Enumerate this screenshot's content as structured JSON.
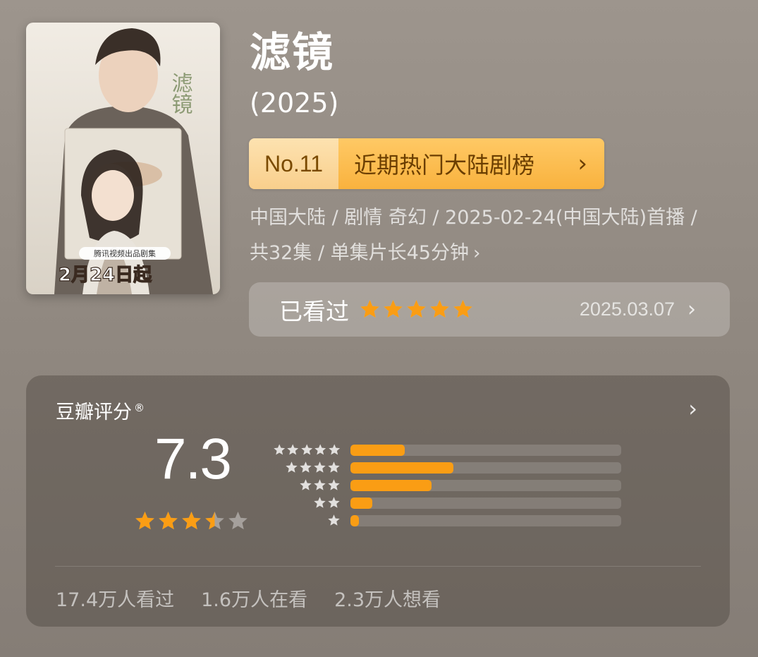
{
  "poster": {
    "title_text": "滤镜",
    "caption": "腾讯视频出品剧集",
    "date_text": "2月24日起"
  },
  "header": {
    "title": "滤镜",
    "year": "(2025)"
  },
  "rank": {
    "number": "No.11",
    "label": "近期热门大陆剧榜"
  },
  "meta": {
    "info": "中国大陆 / 剧情 奇幻 / 2025-02-24(中国大陆)首播 / 共32集 / 单集片长45分钟"
  },
  "watched": {
    "label": "已看过",
    "user_rating_stars": 5,
    "date": "2025.03.07"
  },
  "douban": {
    "title": "豆瓣评分",
    "registered_mark": "®",
    "score": "7.3",
    "score_stars": 3.5,
    "distribution": [
      {
        "stars": 5,
        "fraction": 0.2
      },
      {
        "stars": 4,
        "fraction": 0.38
      },
      {
        "stars": 3,
        "fraction": 0.3
      },
      {
        "stars": 2,
        "fraction": 0.08
      },
      {
        "stars": 1,
        "fraction": 0.03
      }
    ],
    "stats": {
      "watched": "17.4万人看过",
      "watching": "1.6万人在看",
      "want": "2.3万人想看"
    }
  },
  "colors": {
    "accent_orange": "#fa9d14",
    "rank_gold": "#f9b23e",
    "background": "#948c84"
  }
}
